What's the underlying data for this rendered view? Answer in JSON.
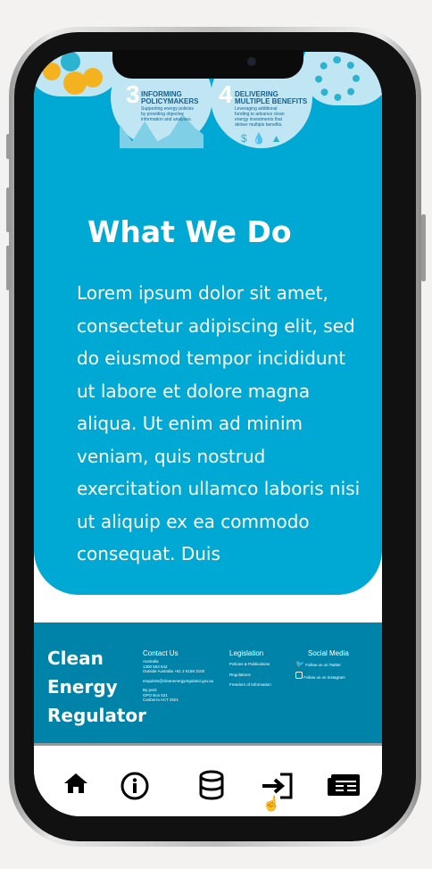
{
  "infographic": {
    "item3": {
      "number": "3",
      "title": "INFORMING POLICYMAKERS",
      "body": "Supporting energy policies by providing objective information and analyses."
    },
    "item4": {
      "number": "4",
      "title": "DELIVERING MULTIPLE BENEFITS",
      "body": "Leveraging additional funding to advance clean energy investments that deliver multiple benefits."
    }
  },
  "section": {
    "title": "What We Do",
    "body": "Lorem ipsum dolor sit amet, consectetur adipiscing elit, sed do eiusmod tempor incididunt ut labore et dolore magna aliqua. Ut enim ad minim veniam, quis nostrud exercitation ullamco laboris nisi ut aliquip ex ea commodo consequat. Duis"
  },
  "footer": {
    "brand": [
      "Clean",
      "Energy",
      "Regulator"
    ],
    "contact": {
      "title": "Contact Us",
      "lines": [
        "Australia",
        "1300 553 542",
        "Outside Australia +61 2 6159 3100",
        "enquiries@cleanenergyregulator.gov.au",
        "By post:",
        "GPO Box 621",
        "Canberra ACT 2601"
      ]
    },
    "legislation": {
      "title": "Legislation",
      "links": [
        "Policies & Publications",
        "Regulations",
        "Freedom of Information"
      ]
    },
    "social": {
      "title": "Social Media",
      "twitter": "Follow us on Twitter",
      "instagram": "Follow us on Instagram"
    }
  },
  "colors": {
    "primary": "#00a9d3",
    "footer": "#0083a9"
  },
  "nav": [
    "home-icon",
    "info-icon",
    "database-icon",
    "login-icon",
    "newspaper-icon"
  ]
}
